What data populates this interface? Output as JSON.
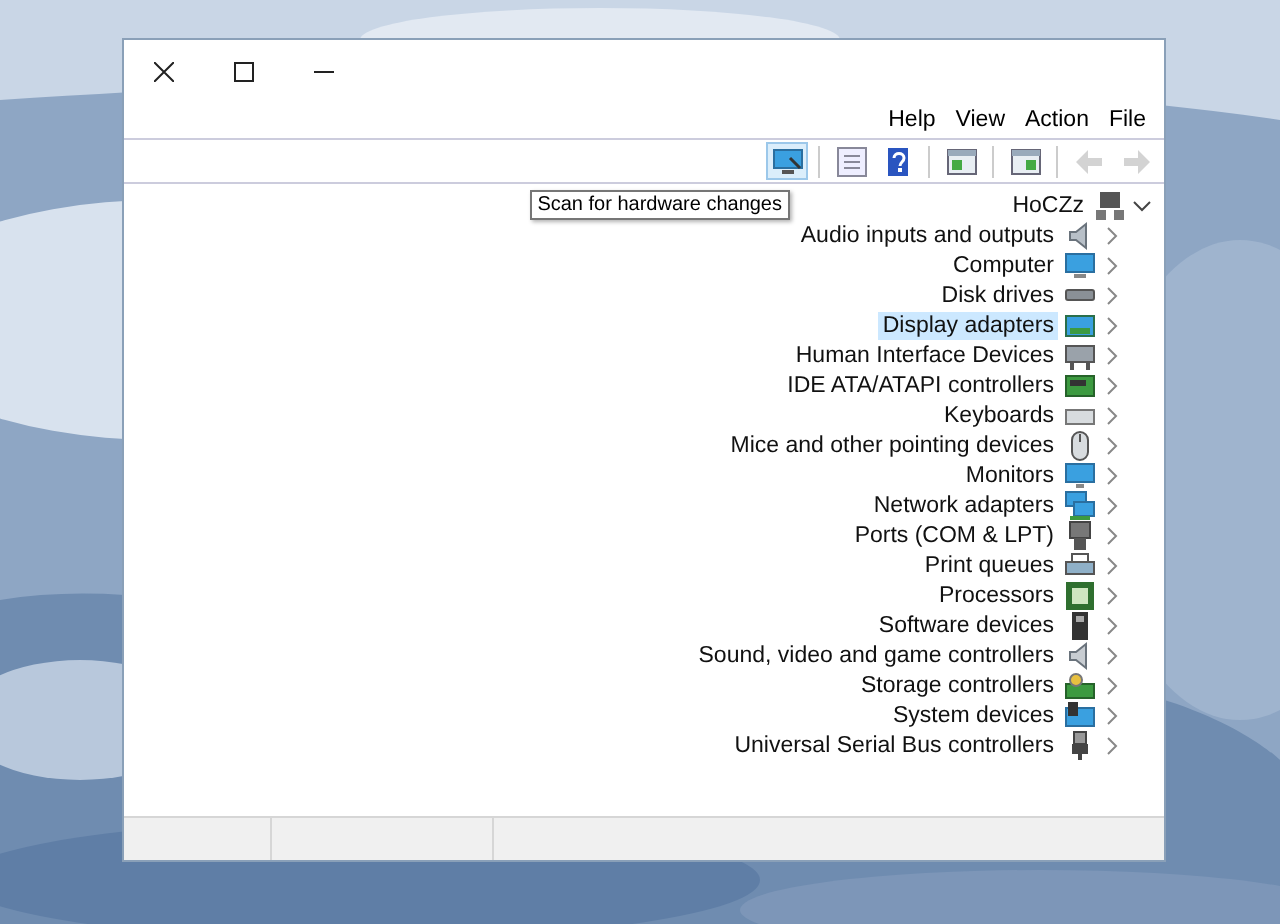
{
  "window": {
    "menu": [
      {
        "label": "Help"
      },
      {
        "label": "View"
      },
      {
        "label": "Action"
      },
      {
        "label": "File"
      }
    ],
    "toolbar": [
      {
        "kind": "scan",
        "disabled": false,
        "hovered": true
      },
      {
        "kind": "separator"
      },
      {
        "kind": "view",
        "disabled": false,
        "hovered": false
      },
      {
        "kind": "help",
        "disabled": false,
        "hovered": false
      },
      {
        "kind": "separator"
      },
      {
        "kind": "update",
        "disabled": false,
        "hovered": false
      },
      {
        "kind": "separator"
      },
      {
        "kind": "properties",
        "disabled": false,
        "hovered": false
      },
      {
        "kind": "separator"
      },
      {
        "kind": "back",
        "disabled": true,
        "hovered": false
      },
      {
        "kind": "forward",
        "disabled": true,
        "hovered": false
      }
    ],
    "tooltip": "Scan for hardware changes",
    "tree": [
      {
        "label": "HoCZz",
        "kind": "root",
        "expanded": true,
        "selected": false,
        "children": [
          {
            "label": "Audio inputs and outputs",
            "kind": "audio",
            "expanded": false,
            "selected": false
          },
          {
            "label": "Computer",
            "kind": "computer",
            "expanded": false,
            "selected": false
          },
          {
            "label": "Disk drives",
            "kind": "disk",
            "expanded": false,
            "selected": false
          },
          {
            "label": "Display adapters",
            "kind": "display",
            "expanded": false,
            "selected": true
          },
          {
            "label": "Human Interface Devices",
            "kind": "hid",
            "expanded": false,
            "selected": false
          },
          {
            "label": "IDE ATA/ATAPI controllers",
            "kind": "ide",
            "expanded": false,
            "selected": false
          },
          {
            "label": "Keyboards",
            "kind": "keyboard",
            "expanded": false,
            "selected": false
          },
          {
            "label": "Mice and other pointing devices",
            "kind": "mouse",
            "expanded": false,
            "selected": false
          },
          {
            "label": "Monitors",
            "kind": "monitor",
            "expanded": false,
            "selected": false
          },
          {
            "label": "Network adapters",
            "kind": "network",
            "expanded": false,
            "selected": false
          },
          {
            "label": "Ports (COM & LPT)",
            "kind": "port",
            "expanded": false,
            "selected": false
          },
          {
            "label": "Print queues",
            "kind": "printer",
            "expanded": false,
            "selected": false
          },
          {
            "label": "Processors",
            "kind": "processor",
            "expanded": false,
            "selected": false
          },
          {
            "label": "Software devices",
            "kind": "software",
            "expanded": false,
            "selected": false
          },
          {
            "label": "Sound, video and game controllers",
            "kind": "sound",
            "expanded": false,
            "selected": false
          },
          {
            "label": "Storage controllers",
            "kind": "storage",
            "expanded": false,
            "selected": false
          },
          {
            "label": "System devices",
            "kind": "system",
            "expanded": false,
            "selected": false
          },
          {
            "label": "Universal Serial Bus controllers",
            "kind": "usb",
            "expanded": false,
            "selected": false
          }
        ]
      }
    ]
  }
}
